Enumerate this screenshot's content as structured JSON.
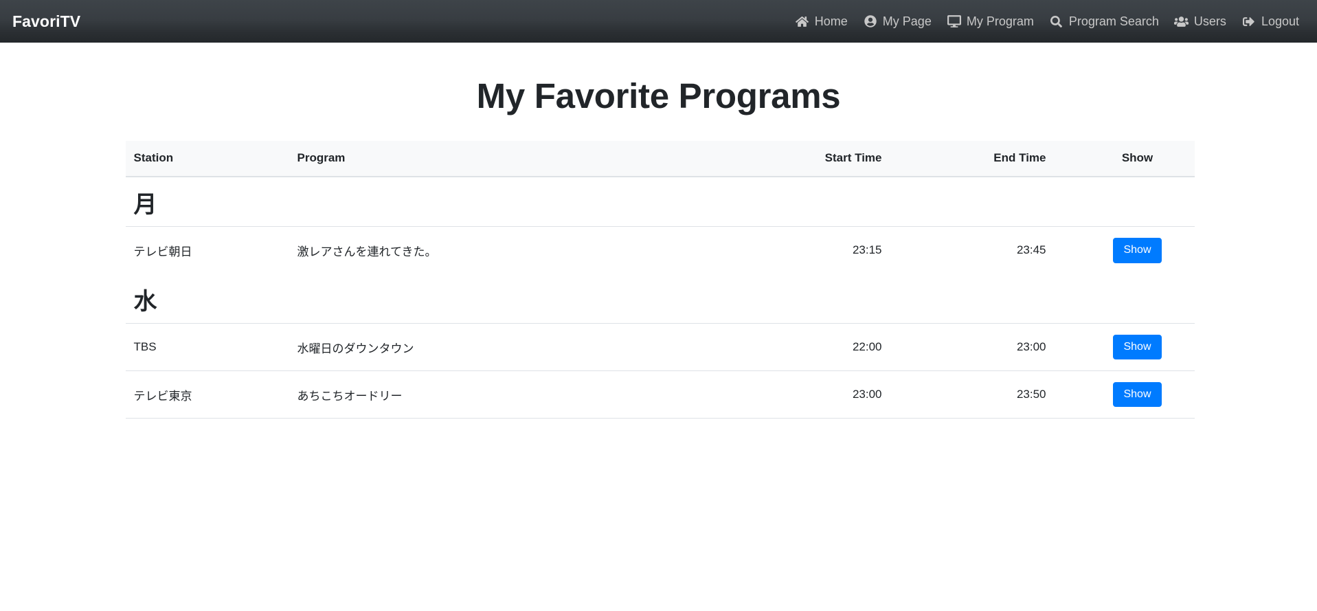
{
  "navbar": {
    "brand": "FavoriTV",
    "items": [
      {
        "label": "Home",
        "icon": "home-icon"
      },
      {
        "label": "My Page",
        "icon": "user-circle-icon"
      },
      {
        "label": "My Program",
        "icon": "desktop-icon"
      },
      {
        "label": "Program Search",
        "icon": "search-icon"
      },
      {
        "label": "Users",
        "icon": "users-icon"
      },
      {
        "label": "Logout",
        "icon": "sign-out-icon"
      }
    ]
  },
  "page": {
    "title": "My Favorite Programs"
  },
  "table": {
    "headers": {
      "station": "Station",
      "program": "Program",
      "start": "Start Time",
      "end": "End Time",
      "show": "Show"
    },
    "groups": [
      {
        "day": "月",
        "rows": [
          {
            "station": "テレビ朝日",
            "program": "激レアさんを連れてきた。",
            "start": "23:15",
            "end": "23:45",
            "action": "Show"
          }
        ]
      },
      {
        "day": "水",
        "rows": [
          {
            "station": "TBS",
            "program": "水曜日のダウンタウン",
            "start": "22:00",
            "end": "23:00",
            "action": "Show"
          },
          {
            "station": "テレビ東京",
            "program": "あちこちオードリー",
            "start": "23:00",
            "end": "23:50",
            "action": "Show"
          }
        ]
      }
    ]
  },
  "colors": {
    "navbar_top": "#3e4449",
    "navbar_bottom": "#24282b",
    "primary": "#007bff",
    "text": "#212529",
    "table_head_bg": "#f8f9fa",
    "border": "#dee2e6",
    "nav_link": "#c8c8c8"
  }
}
